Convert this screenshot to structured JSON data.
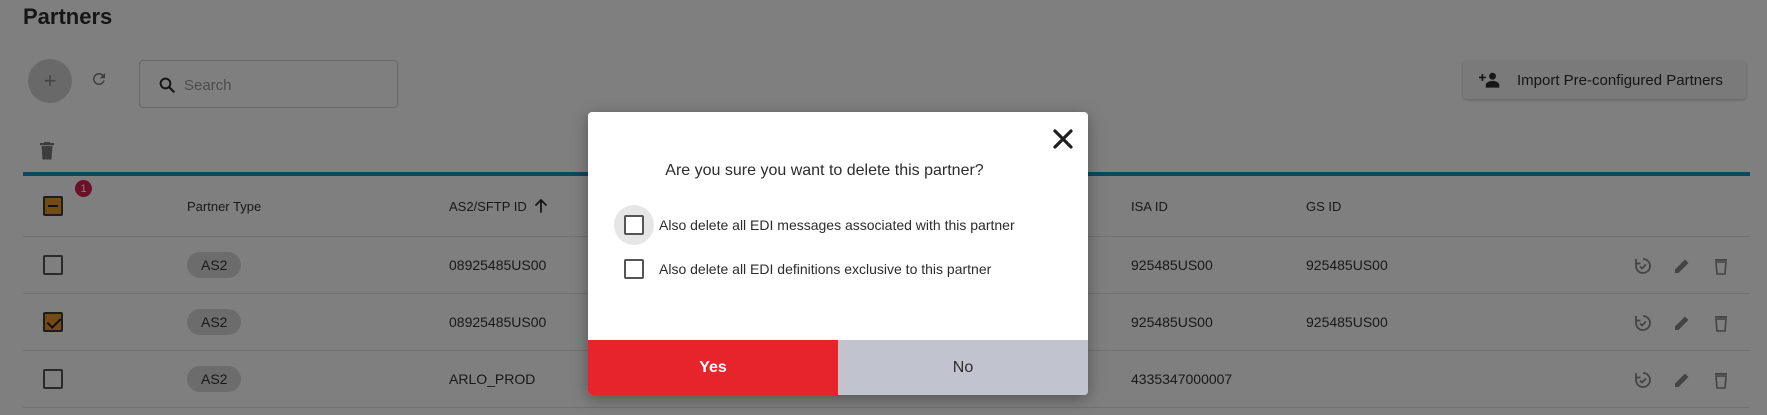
{
  "page": {
    "title": "Partners"
  },
  "toolbar": {
    "search_placeholder": "Search",
    "import_label": "Import Pre-configured Partners"
  },
  "table": {
    "selected_count": "1",
    "headers": {
      "partner_type": "Partner Type",
      "as2_sftp_id": "AS2/SFTP ID",
      "isa_id": "ISA ID",
      "gs_id": "GS ID"
    },
    "sort": {
      "column": "as2_sftp_id",
      "direction": "ascending"
    },
    "rows": [
      {
        "checked": false,
        "partner_type": "AS2",
        "as2_sftp_id": "08925485US00",
        "isa_id": "925485US00",
        "gs_id": "925485US00"
      },
      {
        "checked": true,
        "partner_type": "AS2",
        "as2_sftp_id": "08925485US00",
        "isa_id": "925485US00",
        "gs_id": "925485US00"
      },
      {
        "checked": false,
        "partner_type": "AS2",
        "as2_sftp_id": "ARLO_PROD",
        "isa_id": "4335347000007",
        "gs_id": ""
      }
    ]
  },
  "dialog": {
    "question": "Are you sure you want to delete this partner?",
    "option_messages": "Also delete all EDI messages associated with this partner",
    "option_definitions": "Also delete all EDI definitions exclusive to this partner",
    "yes_label": "Yes",
    "no_label": "No"
  },
  "colors": {
    "accent_blue": "#1a8fc0",
    "checkbox_orange": "#e8952a",
    "yes_red": "#e7232b",
    "no_gray": "#c1c4ce",
    "badge_pink": "#d8204e"
  }
}
